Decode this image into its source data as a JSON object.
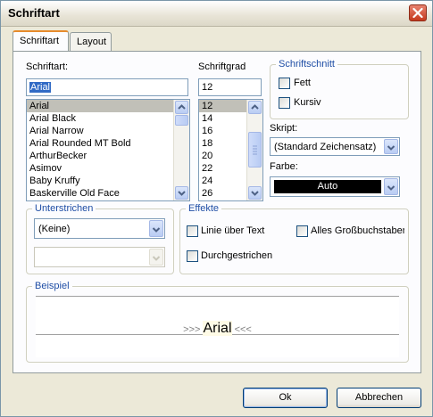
{
  "window": {
    "title": "Schriftart"
  },
  "tabs": [
    {
      "label": "Schriftart"
    },
    {
      "label": "Layout"
    }
  ],
  "font": {
    "label": "Schriftart:",
    "value": "Arial",
    "items": [
      "Arial",
      "Arial Black",
      "Arial Narrow",
      "Arial Rounded MT Bold",
      "ArthurBecker",
      "Asimov",
      "Baby Kruffy",
      "Baskerville Old Face"
    ],
    "selected_index": 0
  },
  "size": {
    "label": "Schriftgrad",
    "value": "12",
    "items": [
      "12",
      "14",
      "16",
      "18",
      "20",
      "22",
      "24",
      "26"
    ],
    "selected_index": 0
  },
  "style": {
    "title": "Schriftschnitt",
    "bold_label": "Fett",
    "italic_label": "Kursiv",
    "bold_checked": false,
    "italic_checked": false
  },
  "script": {
    "label": "Skript:",
    "value": "(Standard Zeichensatz)"
  },
  "color": {
    "label": "Farbe:",
    "value": "Auto",
    "swatch": "#000000"
  },
  "underline": {
    "title": "Unterstrichen",
    "value": "(Keine)",
    "color_value": ""
  },
  "effects": {
    "title": "Effekte",
    "overline_label": "Linie über Text",
    "allcaps_label": "Alles Großbuchstaben",
    "strike_label": "Durchgestrichen"
  },
  "preview": {
    "title": "Beispiel",
    "left_marker": ">>>",
    "sample": "Arial",
    "right_marker": "<<<",
    "marker_color": "#808080"
  },
  "buttons": {
    "ok": "Ok",
    "cancel": "Abbrechen"
  },
  "colors": {
    "accent": "#1f4ea5",
    "selection": "#316ac5",
    "tab_highlight": "#e68b2c"
  }
}
